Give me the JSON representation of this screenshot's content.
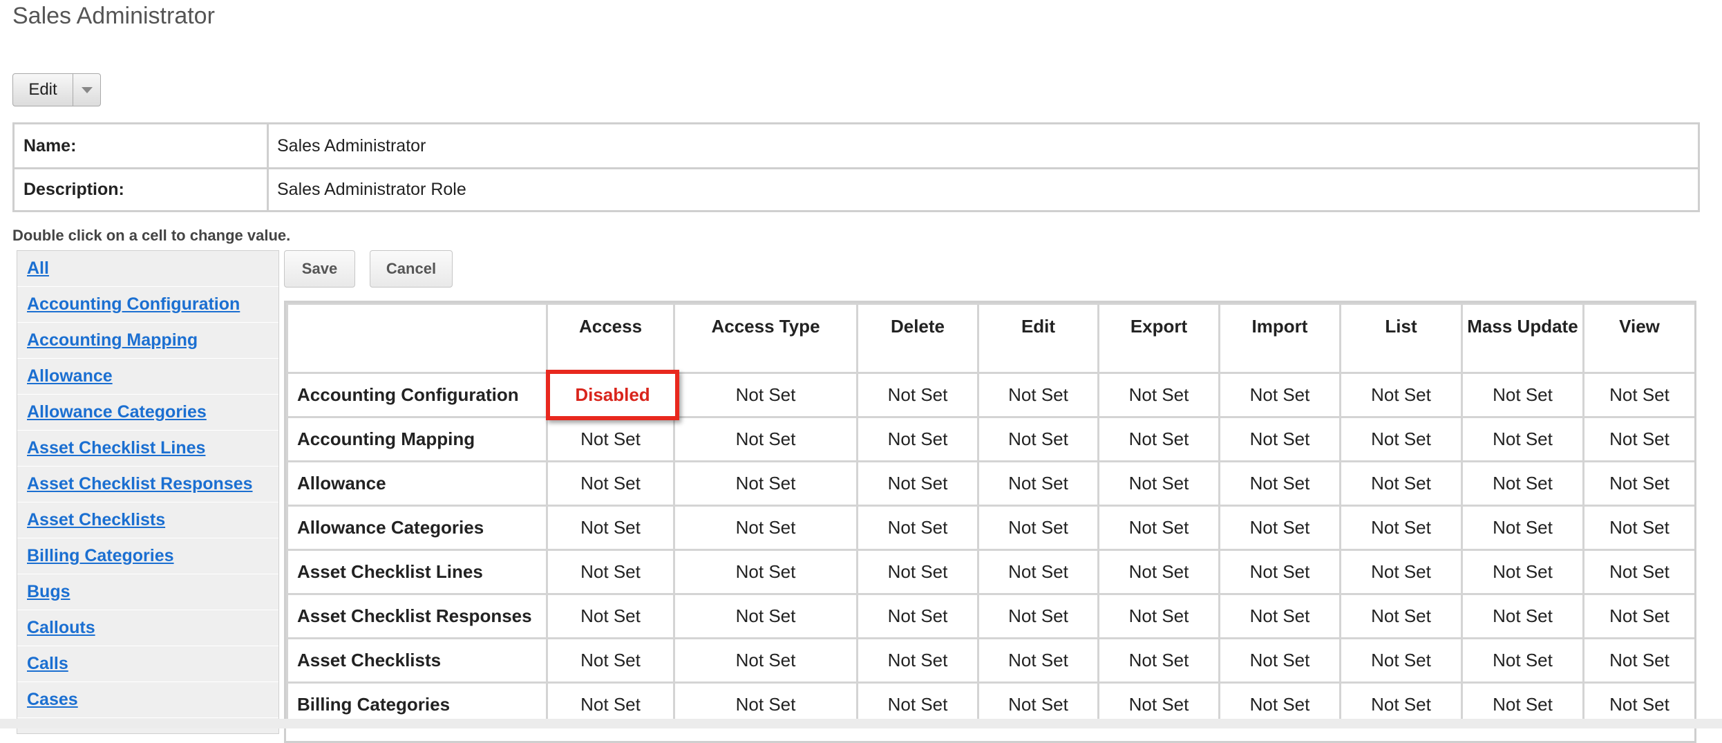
{
  "title": "Sales Administrator",
  "edit_button": {
    "label": "Edit"
  },
  "details": {
    "name_label": "Name:",
    "name_value": "Sales Administrator",
    "description_label": "Description:",
    "description_value": "Sales Administrator Role"
  },
  "hint": "Double click on a cell to change value.",
  "sidebar": {
    "items": [
      "All",
      "Accounting Configuration",
      "Accounting Mapping",
      "Allowance",
      "Allowance Categories",
      "Asset Checklist Lines",
      "Asset Checklist Responses",
      "Asset Checklists",
      "Billing Categories",
      "Bugs",
      "Callouts",
      "Calls",
      "Cases"
    ]
  },
  "actions": {
    "save": "Save",
    "cancel": "Cancel"
  },
  "grid": {
    "columns": [
      "",
      "Access",
      "Access Type",
      "Delete",
      "Edit",
      "Export",
      "Import",
      "List",
      "Mass Update",
      "View"
    ],
    "rows": [
      {
        "module": "Accounting Configuration",
        "values": [
          "Disabled",
          "Not Set",
          "Not Set",
          "Not Set",
          "Not Set",
          "Not Set",
          "Not Set",
          "Not Set",
          "Not Set"
        ]
      },
      {
        "module": "Accounting Mapping",
        "values": [
          "Not Set",
          "Not Set",
          "Not Set",
          "Not Set",
          "Not Set",
          "Not Set",
          "Not Set",
          "Not Set",
          "Not Set"
        ]
      },
      {
        "module": "Allowance",
        "values": [
          "Not Set",
          "Not Set",
          "Not Set",
          "Not Set",
          "Not Set",
          "Not Set",
          "Not Set",
          "Not Set",
          "Not Set"
        ]
      },
      {
        "module": "Allowance Categories",
        "values": [
          "Not Set",
          "Not Set",
          "Not Set",
          "Not Set",
          "Not Set",
          "Not Set",
          "Not Set",
          "Not Set",
          "Not Set"
        ]
      },
      {
        "module": "Asset Checklist Lines",
        "values": [
          "Not Set",
          "Not Set",
          "Not Set",
          "Not Set",
          "Not Set",
          "Not Set",
          "Not Set",
          "Not Set",
          "Not Set"
        ]
      },
      {
        "module": "Asset Checklist Responses",
        "values": [
          "Not Set",
          "Not Set",
          "Not Set",
          "Not Set",
          "Not Set",
          "Not Set",
          "Not Set",
          "Not Set",
          "Not Set"
        ]
      },
      {
        "module": "Asset Checklists",
        "values": [
          "Not Set",
          "Not Set",
          "Not Set",
          "Not Set",
          "Not Set",
          "Not Set",
          "Not Set",
          "Not Set",
          "Not Set"
        ]
      },
      {
        "module": "Billing Categories",
        "values": [
          "Not Set",
          "Not Set",
          "Not Set",
          "Not Set",
          "Not Set",
          "Not Set",
          "Not Set",
          "Not Set",
          "Not Set"
        ]
      }
    ]
  },
  "colors": {
    "link": "#1b6fd1",
    "highlight": "#e8281e",
    "disabled_text": "#d9251c",
    "border": "#cfcfcf"
  },
  "icons": {
    "edit_dropdown": "chevron-down-icon"
  }
}
